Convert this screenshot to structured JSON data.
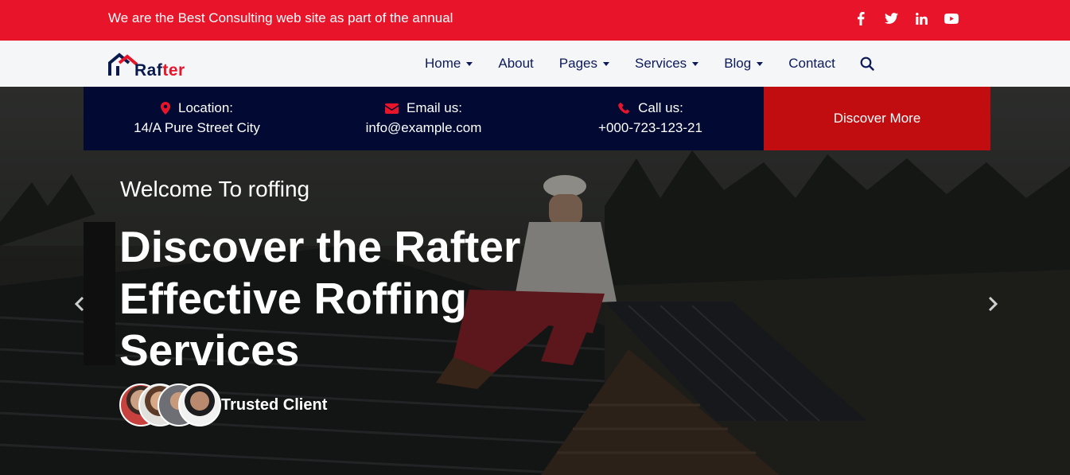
{
  "topbar": {
    "message": "We are the Best Consulting web site as part of the annual",
    "socials": [
      "facebook-icon",
      "twitter-icon",
      "linkedin-icon",
      "youtube-icon"
    ],
    "color": "#e8142a"
  },
  "logo": {
    "part1": "Raf",
    "part2": "ter"
  },
  "nav": {
    "items": [
      {
        "label": "Home",
        "dropdown": true
      },
      {
        "label": "About",
        "dropdown": false
      },
      {
        "label": "Pages",
        "dropdown": true
      },
      {
        "label": "Services",
        "dropdown": true
      },
      {
        "label": "Blog",
        "dropdown": true
      },
      {
        "label": "Contact",
        "dropdown": false
      }
    ]
  },
  "info": {
    "location": {
      "title": "Location:",
      "value": "14/A Pure Street City"
    },
    "email": {
      "title": "Email us:",
      "value": "info@example.com"
    },
    "call": {
      "title": "Call us:",
      "value": "+000-723-123-21"
    },
    "cta": "Discover More"
  },
  "hero": {
    "welcome": "Welcome To roffing",
    "headline_line1": "Discover the Rafter",
    "headline_line2": "Effective Roffing",
    "headline_line3": "Services",
    "trusted": "Trusted Client"
  },
  "colors": {
    "accent": "#e8142a",
    "navy": "#020a33",
    "cta": "#c10d10"
  }
}
